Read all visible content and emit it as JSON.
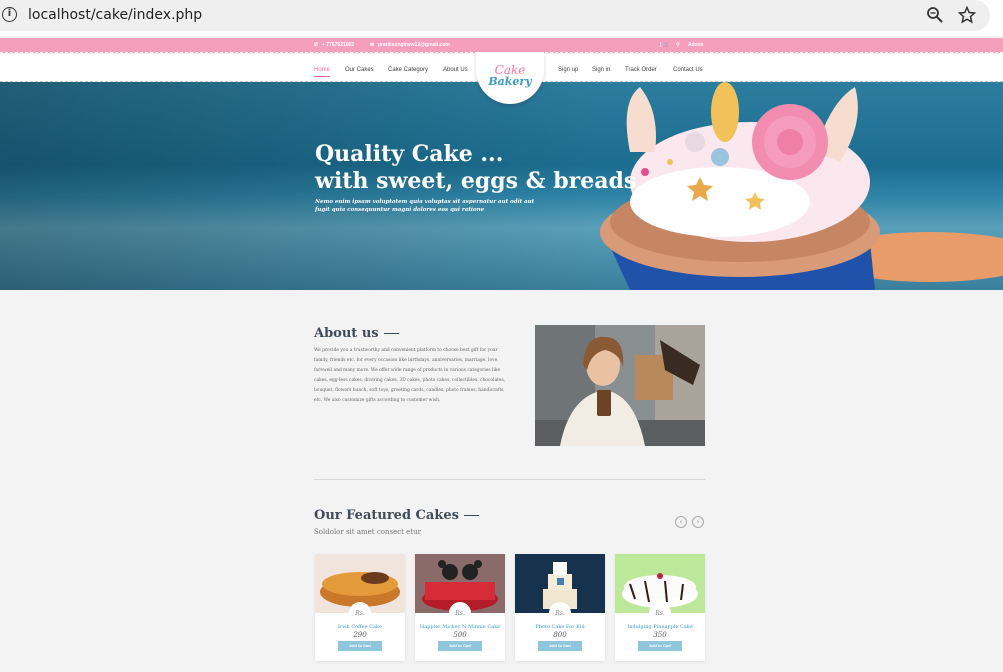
{
  "browser": {
    "url": "localhost/cake/index.php"
  },
  "topbar": {
    "phone": "+ 7767821602",
    "email": "pratiksongirww12@gmail.com",
    "cart_icon": "cart-icon",
    "admin": "Admin"
  },
  "nav": {
    "left": [
      "Home",
      "Our Cakes",
      "Cake Category",
      "About Us"
    ],
    "right": [
      "Sign up",
      "Sign in",
      "Track Order",
      "Contact Us"
    ],
    "logo_line1": "Cake",
    "logo_line2": "Bakery"
  },
  "hero": {
    "title_line1": "Quality Cake ...",
    "title_line2": "with sweet, eggs & breads",
    "text": "Nemo enim ipsam voluptatem quia voluptas sit aspernatur aut odit aut fugit quia consequuntur magni dolores eos qui ratione"
  },
  "about": {
    "title": "About us",
    "text": "We provide you a trustworthy and convenient platform to choose best gift for your family, friends etc. for every occasion like birthdays, anniversaries, marriage, love, farewell and many more. We offer wide range of products in various categories like cakes, egg-less cakes, drawing cakes, 3D cakes, photo cakes, collectibles, chocolates, bouquet, flowers bunch, soft toys, greeting cards, candles, photo frames, handicrafts etc. We also customize gifts according to customer wish."
  },
  "featured": {
    "title": "Our Featured Cakes",
    "subtitle": "Soldolor sit amet consect etur",
    "currency": "Rs.",
    "add_label": "Add to Cart",
    "cakes": [
      {
        "name": "Irish Coffee Cake",
        "price": "290"
      },
      {
        "name": "Happier Mickey N Minnie Cake",
        "price": "500"
      },
      {
        "name": "Photo Cake For Kid",
        "price": "800"
      },
      {
        "name": "Indulging Pineapple Cake",
        "price": "350"
      }
    ]
  },
  "colors": {
    "pink": "#f59fbd",
    "blue": "#3a9bc4"
  }
}
